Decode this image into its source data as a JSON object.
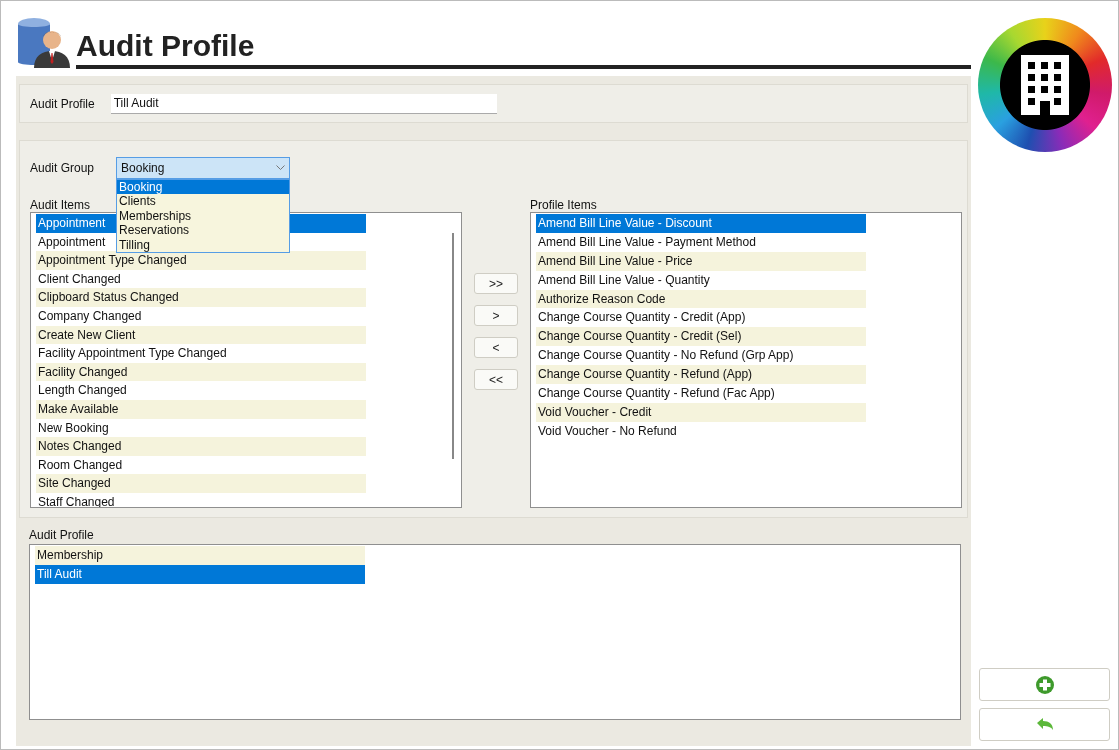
{
  "header": {
    "title": "Audit Profile"
  },
  "profile": {
    "label": "Audit Profile",
    "value": "Till Audit"
  },
  "audit_group": {
    "label": "Audit Group",
    "value": "Booking",
    "expanded": true,
    "options": [
      {
        "label": "Booking",
        "selected": true
      },
      {
        "label": "Clients",
        "selected": false
      },
      {
        "label": "Memberships",
        "selected": false
      },
      {
        "label": "Reservations",
        "selected": false
      },
      {
        "label": "Tilling",
        "selected": false
      }
    ]
  },
  "audit_items": {
    "label": "Audit Items",
    "rows": [
      {
        "text": "Appointment",
        "selected": true
      },
      {
        "text": "Appointment",
        "selected": false
      },
      {
        "text": "Appointment Type Changed",
        "selected": false
      },
      {
        "text": "Client Changed",
        "selected": false
      },
      {
        "text": "Clipboard Status Changed",
        "selected": false
      },
      {
        "text": "Company Changed",
        "selected": false
      },
      {
        "text": "Create New Client",
        "selected": false
      },
      {
        "text": "Facility Appointment Type Changed",
        "selected": false
      },
      {
        "text": "Facility Changed",
        "selected": false
      },
      {
        "text": "Length Changed",
        "selected": false
      },
      {
        "text": "Make Available",
        "selected": false
      },
      {
        "text": "New Booking",
        "selected": false
      },
      {
        "text": "Notes Changed",
        "selected": false
      },
      {
        "text": "Room Changed",
        "selected": false
      },
      {
        "text": "Site Changed",
        "selected": false
      },
      {
        "text": "Staff Changed",
        "selected": false
      }
    ]
  },
  "transfer_buttons": [
    ">>",
    ">",
    "<",
    "<<"
  ],
  "profile_items": {
    "label": "Profile Items",
    "rows": [
      {
        "text": "Amend Bill Line Value - Discount",
        "selected": true
      },
      {
        "text": "Amend Bill Line Value - Payment Method",
        "selected": false
      },
      {
        "text": "Amend Bill Line Value - Price",
        "selected": false
      },
      {
        "text": "Amend Bill Line Value - Quantity",
        "selected": false
      },
      {
        "text": "Authorize Reason Code",
        "selected": false
      },
      {
        "text": "Change Course Quantity - Credit (App)",
        "selected": false
      },
      {
        "text": "Change Course Quantity - Credit (Sel)",
        "selected": false
      },
      {
        "text": "Change Course Quantity - No Refund (Grp App)",
        "selected": false
      },
      {
        "text": "Change Course Quantity - Refund (App)",
        "selected": false
      },
      {
        "text": "Change Course Quantity - Refund (Fac App)",
        "selected": false
      },
      {
        "text": "Void Voucher - Credit",
        "selected": false
      },
      {
        "text": "Void Voucher - No Refund",
        "selected": false
      }
    ]
  },
  "audit_profiles": {
    "label": "Audit Profile",
    "rows": [
      {
        "text": "Membership",
        "selected": false
      },
      {
        "text": "Till Audit",
        "selected": true
      }
    ]
  }
}
